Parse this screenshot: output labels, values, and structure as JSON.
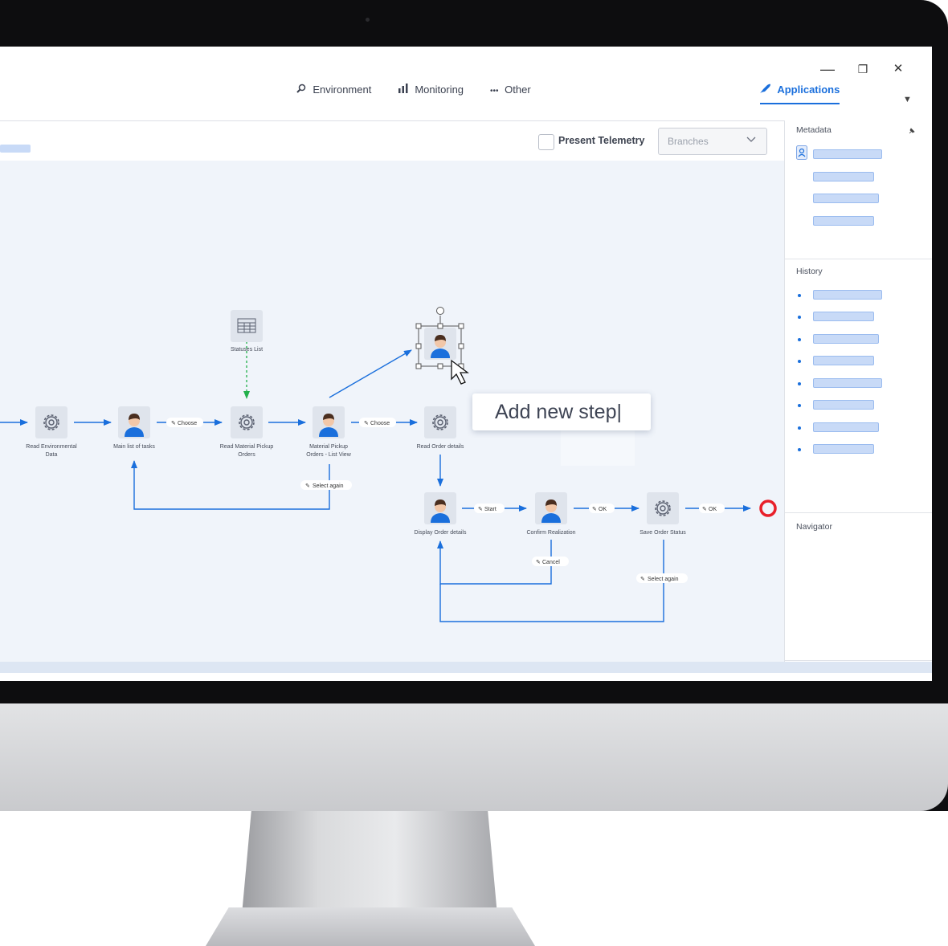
{
  "window": {
    "controls": {
      "minimize": "—",
      "restore": "❐",
      "close": "✕",
      "menu": "▼"
    }
  },
  "nav": {
    "items": [
      {
        "label": "Applications",
        "icon": "rocket-icon",
        "glyph": "🚀",
        "active": true
      },
      {
        "label": "Environment",
        "icon": "environment-icon",
        "glyph": "⚙",
        "active": false
      },
      {
        "label": "Monitoring",
        "icon": "bar-chart-icon",
        "glyph": "▮",
        "active": false
      },
      {
        "label": "Other",
        "icon": "more-icon",
        "glyph": "•••",
        "active": false
      }
    ]
  },
  "toolbar": {
    "telemetry_label": "Present Telemetry",
    "telemetry_checked": false,
    "branches_value": "Branches"
  },
  "editor": {
    "step_input_value": "Add new step|"
  },
  "nodes": [
    {
      "id": "statuses",
      "label1": "Statuses List",
      "label2": "",
      "kind": "table"
    },
    {
      "id": "read-env",
      "label1": "Read Environmental",
      "label2": "Data",
      "kind": "gear"
    },
    {
      "id": "main-tasks",
      "label1": "Main list of tasks",
      "label2": "",
      "kind": "user"
    },
    {
      "id": "read-pickup",
      "label1": "Read Material Pickup",
      "label2": "Orders",
      "kind": "gear"
    },
    {
      "id": "pickup-list",
      "label1": "Material Pickup",
      "label2": "Orders - List View",
      "kind": "user"
    },
    {
      "id": "read-order",
      "label1": "Read Order details",
      "label2": "",
      "kind": "gear"
    },
    {
      "id": "display-order",
      "label1": "Display Order details",
      "label2": "",
      "kind": "user"
    },
    {
      "id": "confirm",
      "label1": "Confirm Realization",
      "label2": "",
      "kind": "user"
    },
    {
      "id": "save-status",
      "label1": "Save Order Status",
      "label2": "",
      "kind": "gear"
    },
    {
      "id": "new-step",
      "label1": "",
      "label2": "",
      "kind": "user"
    }
  ],
  "edge_labels": [
    {
      "id": "choose-1",
      "text": "Choose"
    },
    {
      "id": "choose-2",
      "text": "Choose"
    },
    {
      "id": "select-again-1",
      "text": "Select again"
    },
    {
      "id": "start",
      "text": "Start"
    },
    {
      "id": "ok-1",
      "text": "OK"
    },
    {
      "id": "ok-2",
      "text": "OK"
    },
    {
      "id": "cancel",
      "text": "Cancel"
    },
    {
      "id": "select-again-2",
      "text": "Select again"
    }
  ],
  "side_panel": {
    "metadata_title": "Metadata",
    "history_title": "History",
    "navigator_title": "Navigator",
    "metadata_icon": "user-badge-icon",
    "history_items_count": 8
  },
  "colors": {
    "accent": "#1a6fdc",
    "edge": "#1a6fdc",
    "dashed_edge": "#22b04b",
    "end_node": "#e8202a",
    "canvas_bg": "#f0f4fa"
  }
}
